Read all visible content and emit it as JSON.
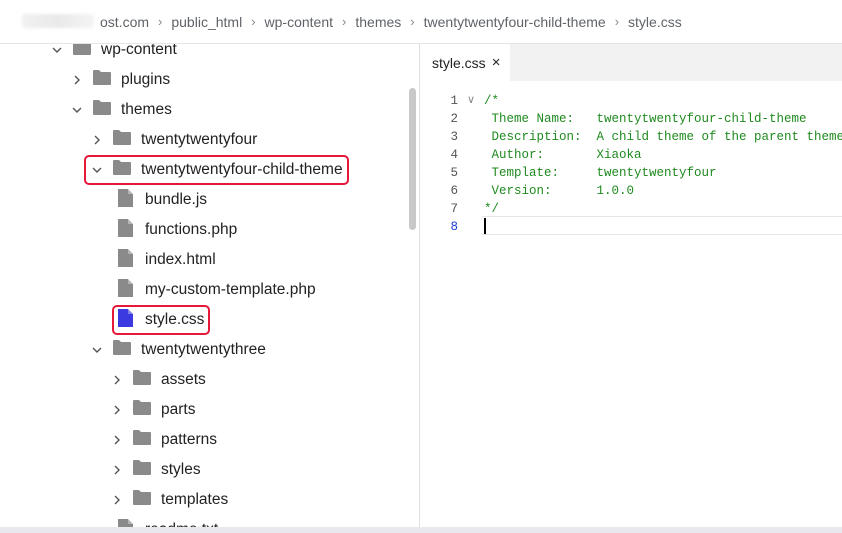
{
  "breadcrumb": {
    "items": [
      "ost.com",
      "public_html",
      "wp-content",
      "themes",
      "twentytwentyfour-child-theme",
      "style.css"
    ],
    "separator": "›"
  },
  "tree": {
    "items": [
      {
        "label": "wp-content",
        "kind": "folder",
        "state": "expanded",
        "depth": 0
      },
      {
        "label": "plugins",
        "kind": "folder",
        "state": "collapsed",
        "depth": 1
      },
      {
        "label": "themes",
        "kind": "folder",
        "state": "expanded",
        "depth": 1
      },
      {
        "label": "twentytwentyfour",
        "kind": "folder",
        "state": "collapsed",
        "depth": 2
      },
      {
        "label": "twentytwentyfour-child-theme",
        "kind": "folder",
        "state": "expanded",
        "depth": 2,
        "highlighted": true
      },
      {
        "label": "bundle.js",
        "kind": "file",
        "depth": 3
      },
      {
        "label": "functions.php",
        "kind": "file",
        "depth": 3
      },
      {
        "label": "index.html",
        "kind": "file",
        "depth": 3
      },
      {
        "label": "my-custom-template.php",
        "kind": "file",
        "depth": 3
      },
      {
        "label": "style.css",
        "kind": "file",
        "depth": 3,
        "selected": true,
        "highlighted": true
      },
      {
        "label": "twentytwentythree",
        "kind": "folder",
        "state": "expanded",
        "depth": 2
      },
      {
        "label": "assets",
        "kind": "folder",
        "state": "collapsed",
        "depth": 3
      },
      {
        "label": "parts",
        "kind": "folder",
        "state": "collapsed",
        "depth": 3
      },
      {
        "label": "patterns",
        "kind": "folder",
        "state": "collapsed",
        "depth": 3
      },
      {
        "label": "styles",
        "kind": "folder",
        "state": "collapsed",
        "depth": 3
      },
      {
        "label": "templates",
        "kind": "folder",
        "state": "collapsed",
        "depth": 3
      },
      {
        "label": "readme.txt",
        "kind": "file",
        "depth": 3
      }
    ]
  },
  "editor": {
    "tab_label": "style.css",
    "tab_close": "×",
    "lines": [
      {
        "n": "1",
        "text": "/*",
        "fold": "∨"
      },
      {
        "n": "2",
        "text": " Theme Name:   twentytwentyfour-child-theme"
      },
      {
        "n": "3",
        "text": " Description:  A child theme of the parent theme"
      },
      {
        "n": "4",
        "text": " Author:       Xiaoka"
      },
      {
        "n": "5",
        "text": " Template:     twentytwentyfour"
      },
      {
        "n": "6",
        "text": " Version:      1.0.0"
      },
      {
        "n": "7",
        "text": "*/"
      },
      {
        "n": "8",
        "text": ""
      }
    ],
    "current_line": "8"
  },
  "colors": {
    "highlight": "#e5183a",
    "folder": "#8a8a8a",
    "file": "#8a8a8a",
    "file_selected": "#3a3ae0",
    "code_comment": "#1f8a1f",
    "current_line_number": "#1a3fd0"
  },
  "icons": {
    "folder": "folder-icon",
    "file": "file-icon",
    "expand": "chevron-down-icon",
    "collapse": "chevron-right-icon"
  }
}
